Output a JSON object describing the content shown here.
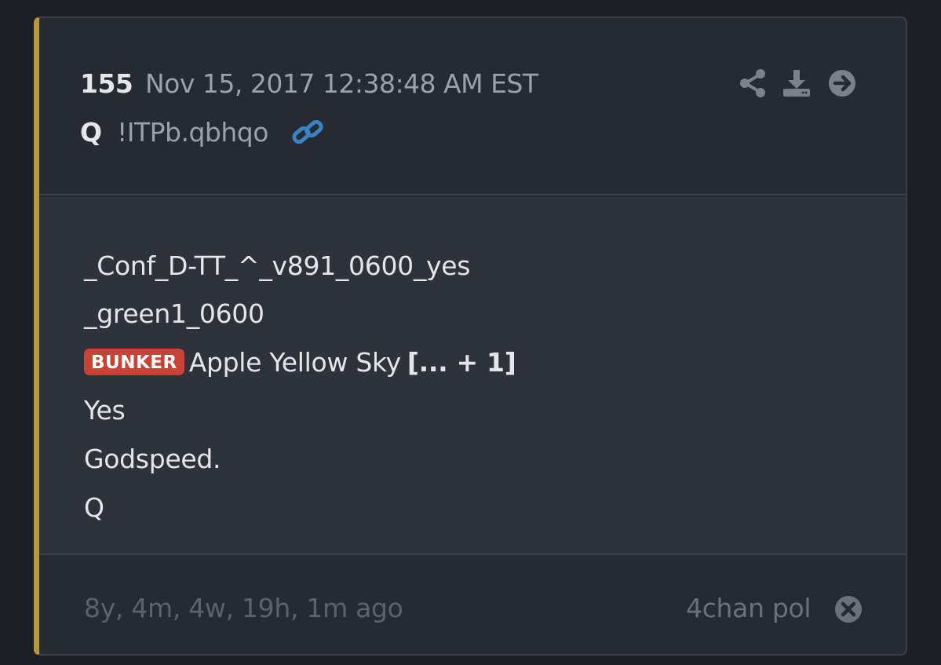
{
  "header": {
    "post_number": "155",
    "date": "Nov 15, 2017 12:38:48 AM EST",
    "author": "Q",
    "tripcode": "!ITPb.qbhqo",
    "icons": [
      "link-icon",
      "share-icon",
      "download-icon",
      "goto-icon"
    ]
  },
  "body": {
    "lines": [
      "_Conf_D-TT_^_v891_0600_yes",
      "_green1_0600",
      "Apple Yellow Sky",
      "Yes",
      "Godspeed.",
      "Q"
    ],
    "badge": "BUNKER",
    "expand_label": "[... + 1]"
  },
  "footer": {
    "ago": "8y, 4m, 4w, 19h, 1m ago",
    "source": "4chan pol",
    "icons": [
      "close-icon"
    ]
  },
  "colors": {
    "accent_bar": "#b59a3c",
    "badge": "#c84236",
    "link": "#3b82c4",
    "card_bg": "#262a32",
    "body_bg": "#2e333b"
  }
}
